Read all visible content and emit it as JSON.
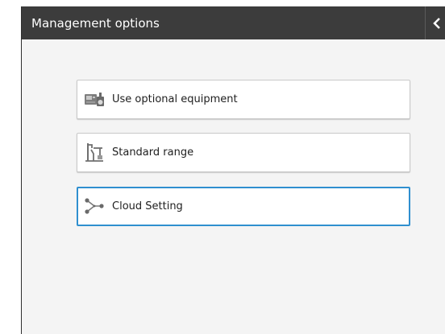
{
  "window": {
    "title": "Management options"
  },
  "options": [
    {
      "label": "Use optional equipment",
      "icon": "optional-equipment-icon",
      "selected": false
    },
    {
      "label": "Standard range",
      "icon": "standard-range-icon",
      "selected": false
    },
    {
      "label": "Cloud Setting",
      "icon": "cloud-setting-icon",
      "selected": true
    }
  ],
  "colors": {
    "titlebar": "#3c3c3c",
    "background": "#f4f4f4",
    "selected_border": "#2f8fcf"
  }
}
